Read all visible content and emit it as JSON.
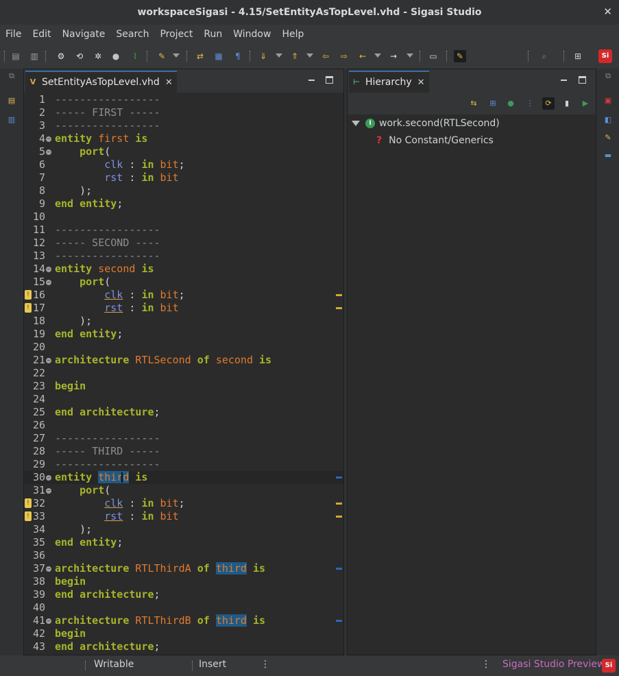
{
  "window": {
    "title": "workspaceSigasi - 4.15/SetEntityAsTopLevel.vhd - Sigasi Studio",
    "close": "✕"
  },
  "menu": [
    "File",
    "Edit",
    "Navigate",
    "Search",
    "Project",
    "Run",
    "Window",
    "Help"
  ],
  "toolbar": {
    "buttons": [
      {
        "name": "save-icon",
        "glyph": "▤",
        "color": "#9aa0a6"
      },
      {
        "name": "save-all-icon",
        "glyph": "▥",
        "color": "#9aa0a6"
      },
      {
        "name": "run-icon",
        "glyph": "⚙",
        "color": "#e6e6e6"
      },
      {
        "name": "simulate-icon",
        "glyph": "⟲",
        "color": "#e6e6e6"
      },
      {
        "name": "debug-icon",
        "glyph": "✲",
        "color": "#e6e6e6"
      },
      {
        "name": "stop-icon",
        "glyph": "●",
        "color": "#c0c2c4"
      },
      {
        "name": "wave-icon",
        "glyph": "⌇",
        "color": "#49a34b"
      },
      {
        "name": "highlight-icon",
        "glyph": "✎",
        "color": "#e8b64a"
      },
      {
        "name": "open-type-icon",
        "glyph": "⇄",
        "color": "#e8b64a"
      },
      {
        "name": "outline-icon",
        "glyph": "▦",
        "color": "#5b8ed6"
      },
      {
        "name": "pilcrow-icon",
        "glyph": "¶",
        "color": "#5b8ed6"
      },
      {
        "name": "next-annotation-icon",
        "glyph": "⇓",
        "color": "#e8b64a"
      },
      {
        "name": "prev-annotation-icon",
        "glyph": "⇑",
        "color": "#e8b64a"
      },
      {
        "name": "last-edit-icon",
        "glyph": "⇦",
        "color": "#e8b64a"
      },
      {
        "name": "next-edit-icon",
        "glyph": "⇨",
        "color": "#e8b64a"
      },
      {
        "name": "back-icon",
        "glyph": "←",
        "color": "#e8b64a"
      },
      {
        "name": "forward-icon",
        "glyph": "→",
        "color": "#e6e6e6"
      },
      {
        "name": "terminal-icon",
        "glyph": "▭",
        "color": "#cfd2d4"
      },
      {
        "name": "edit-mode-icon",
        "glyph": "✎",
        "color": "#e8b64a"
      },
      {
        "name": "search-icon",
        "glyph": "⌕",
        "color": "#8a8c8e"
      },
      {
        "name": "perspective-icon",
        "glyph": "⊞",
        "color": "#cfd2d4"
      }
    ]
  },
  "editor": {
    "tab": {
      "label": "SetEntityAsTopLevel.vhd",
      "icon": "vhdl-file-icon",
      "close": "✕"
    },
    "lines": [
      {
        "n": "1",
        "parts": [
          {
            "c": "cmt",
            "t": "-----------------"
          }
        ]
      },
      {
        "n": "2",
        "parts": [
          {
            "c": "cmt",
            "t": "----- FIRST -----"
          }
        ]
      },
      {
        "n": "3",
        "parts": [
          {
            "c": "cmt",
            "t": "-----------------"
          }
        ]
      },
      {
        "n": "4",
        "fold": true,
        "parts": [
          {
            "c": "kw",
            "t": "entity"
          },
          {
            "c": "sym",
            "t": " "
          },
          {
            "c": "ident",
            "t": "first"
          },
          {
            "c": "sym",
            "t": " "
          },
          {
            "c": "kw",
            "t": "is"
          }
        ]
      },
      {
        "n": "5",
        "fold": true,
        "parts": [
          {
            "c": "sym",
            "t": "    "
          },
          {
            "c": "kw",
            "t": "port"
          },
          {
            "c": "sym",
            "t": "("
          }
        ]
      },
      {
        "n": "6",
        "parts": [
          {
            "c": "sym",
            "t": "        "
          },
          {
            "c": "port",
            "t": "clk"
          },
          {
            "c": "sym",
            "t": " : "
          },
          {
            "c": "kw",
            "t": "in"
          },
          {
            "c": "sym",
            "t": " "
          },
          {
            "c": "ident",
            "t": "bit"
          },
          {
            "c": "sym",
            "t": ";"
          }
        ]
      },
      {
        "n": "7",
        "parts": [
          {
            "c": "sym",
            "t": "        "
          },
          {
            "c": "port",
            "t": "rst"
          },
          {
            "c": "sym",
            "t": " : "
          },
          {
            "c": "kw",
            "t": "in"
          },
          {
            "c": "sym",
            "t": " "
          },
          {
            "c": "ident",
            "t": "bit"
          }
        ]
      },
      {
        "n": "8",
        "parts": [
          {
            "c": "sym",
            "t": "    );"
          }
        ]
      },
      {
        "n": "9",
        "parts": [
          {
            "c": "kw",
            "t": "end"
          },
          {
            "c": "sym",
            "t": " "
          },
          {
            "c": "kw",
            "t": "entity"
          },
          {
            "c": "sym",
            "t": ";"
          }
        ]
      },
      {
        "n": "10",
        "parts": []
      },
      {
        "n": "11",
        "parts": [
          {
            "c": "cmt",
            "t": "-----------------"
          }
        ]
      },
      {
        "n": "12",
        "parts": [
          {
            "c": "cmt",
            "t": "----- SECOND ----"
          }
        ]
      },
      {
        "n": "13",
        "parts": [
          {
            "c": "cmt",
            "t": "-----------------"
          }
        ]
      },
      {
        "n": "14",
        "fold": true,
        "parts": [
          {
            "c": "kw",
            "t": "entity"
          },
          {
            "c": "sym",
            "t": " "
          },
          {
            "c": "ident",
            "t": "second"
          },
          {
            "c": "sym",
            "t": " "
          },
          {
            "c": "kw",
            "t": "is"
          }
        ]
      },
      {
        "n": "15",
        "fold": true,
        "parts": [
          {
            "c": "sym",
            "t": "    "
          },
          {
            "c": "kw",
            "t": "port"
          },
          {
            "c": "sym",
            "t": "("
          }
        ]
      },
      {
        "n": "16",
        "marker": true,
        "ovr": "warn",
        "parts": [
          {
            "c": "sym",
            "t": "        "
          },
          {
            "c": "port warn",
            "t": "clk"
          },
          {
            "c": "sym",
            "t": " : "
          },
          {
            "c": "kw",
            "t": "in"
          },
          {
            "c": "sym",
            "t": " "
          },
          {
            "c": "ident",
            "t": "bit"
          },
          {
            "c": "sym",
            "t": ";"
          }
        ]
      },
      {
        "n": "17",
        "marker": true,
        "ovr": "warn",
        "parts": [
          {
            "c": "sym",
            "t": "        "
          },
          {
            "c": "port warn",
            "t": "rst"
          },
          {
            "c": "sym",
            "t": " : "
          },
          {
            "c": "kw",
            "t": "in"
          },
          {
            "c": "sym",
            "t": " "
          },
          {
            "c": "ident",
            "t": "bit"
          }
        ]
      },
      {
        "n": "18",
        "parts": [
          {
            "c": "sym",
            "t": "    );"
          }
        ]
      },
      {
        "n": "19",
        "parts": [
          {
            "c": "kw",
            "t": "end"
          },
          {
            "c": "sym",
            "t": " "
          },
          {
            "c": "kw",
            "t": "entity"
          },
          {
            "c": "sym",
            "t": ";"
          }
        ]
      },
      {
        "n": "20",
        "parts": []
      },
      {
        "n": "21",
        "fold": true,
        "parts": [
          {
            "c": "kw",
            "t": "architecture"
          },
          {
            "c": "sym",
            "t": " "
          },
          {
            "c": "ident",
            "t": "RTLSecond"
          },
          {
            "c": "sym",
            "t": " "
          },
          {
            "c": "kw",
            "t": "of"
          },
          {
            "c": "sym",
            "t": " "
          },
          {
            "c": "ident",
            "t": "second"
          },
          {
            "c": "sym",
            "t": " "
          },
          {
            "c": "kw",
            "t": "is"
          }
        ]
      },
      {
        "n": "22",
        "parts": []
      },
      {
        "n": "23",
        "parts": [
          {
            "c": "kw",
            "t": "begin"
          }
        ]
      },
      {
        "n": "24",
        "parts": []
      },
      {
        "n": "25",
        "parts": [
          {
            "c": "kw",
            "t": "end"
          },
          {
            "c": "sym",
            "t": " "
          },
          {
            "c": "kw",
            "t": "architecture"
          },
          {
            "c": "sym",
            "t": ";"
          }
        ]
      },
      {
        "n": "26",
        "parts": []
      },
      {
        "n": "27",
        "parts": [
          {
            "c": "cmt",
            "t": "-----------------"
          }
        ]
      },
      {
        "n": "28",
        "parts": [
          {
            "c": "cmt",
            "t": "----- THIRD -----"
          }
        ]
      },
      {
        "n": "29",
        "parts": [
          {
            "c": "cmt",
            "t": "-----------------"
          }
        ]
      },
      {
        "n": "30",
        "fold": true,
        "current": true,
        "ovr": "occ",
        "parts": [
          {
            "c": "kw",
            "t": "entity"
          },
          {
            "c": "sym",
            "t": " "
          },
          {
            "c": "ident hl",
            "t": "third"
          },
          {
            "c": "sym",
            "t": " "
          },
          {
            "c": "kw",
            "t": "is"
          }
        ]
      },
      {
        "n": "31",
        "fold": true,
        "parts": [
          {
            "c": "sym",
            "t": "    "
          },
          {
            "c": "kw",
            "t": "port"
          },
          {
            "c": "sym",
            "t": "("
          }
        ]
      },
      {
        "n": "32",
        "marker": true,
        "ovr": "warn",
        "parts": [
          {
            "c": "sym",
            "t": "        "
          },
          {
            "c": "port warn",
            "t": "clk"
          },
          {
            "c": "sym",
            "t": " : "
          },
          {
            "c": "kw",
            "t": "in"
          },
          {
            "c": "sym",
            "t": " "
          },
          {
            "c": "ident",
            "t": "bit"
          },
          {
            "c": "sym",
            "t": ";"
          }
        ]
      },
      {
        "n": "33",
        "marker": true,
        "ovr": "warn",
        "parts": [
          {
            "c": "sym",
            "t": "        "
          },
          {
            "c": "port warn",
            "t": "rst"
          },
          {
            "c": "sym",
            "t": " : "
          },
          {
            "c": "kw",
            "t": "in"
          },
          {
            "c": "sym",
            "t": " "
          },
          {
            "c": "ident",
            "t": "bit"
          }
        ]
      },
      {
        "n": "34",
        "parts": [
          {
            "c": "sym",
            "t": "    );"
          }
        ]
      },
      {
        "n": "35",
        "parts": [
          {
            "c": "kw",
            "t": "end"
          },
          {
            "c": "sym",
            "t": " "
          },
          {
            "c": "kw",
            "t": "entity"
          },
          {
            "c": "sym",
            "t": ";"
          }
        ]
      },
      {
        "n": "36",
        "parts": []
      },
      {
        "n": "37",
        "fold": true,
        "ovr": "occ",
        "parts": [
          {
            "c": "kw",
            "t": "architecture"
          },
          {
            "c": "sym",
            "t": " "
          },
          {
            "c": "ident",
            "t": "RTLThirdA"
          },
          {
            "c": "sym",
            "t": " "
          },
          {
            "c": "kw",
            "t": "of"
          },
          {
            "c": "sym",
            "t": " "
          },
          {
            "c": "ident hl",
            "t": "third"
          },
          {
            "c": "sym",
            "t": " "
          },
          {
            "c": "kw",
            "t": "is"
          }
        ]
      },
      {
        "n": "38",
        "parts": [
          {
            "c": "kw",
            "t": "begin"
          }
        ]
      },
      {
        "n": "39",
        "parts": [
          {
            "c": "kw",
            "t": "end"
          },
          {
            "c": "sym",
            "t": " "
          },
          {
            "c": "kw",
            "t": "architecture"
          },
          {
            "c": "sym",
            "t": ";"
          }
        ]
      },
      {
        "n": "40",
        "parts": []
      },
      {
        "n": "41",
        "fold": true,
        "ovr": "occ",
        "parts": [
          {
            "c": "kw",
            "t": "architecture"
          },
          {
            "c": "sym",
            "t": " "
          },
          {
            "c": "ident",
            "t": "RTLThirdB"
          },
          {
            "c": "sym",
            "t": " "
          },
          {
            "c": "kw",
            "t": "of"
          },
          {
            "c": "sym",
            "t": " "
          },
          {
            "c": "ident hl",
            "t": "third"
          },
          {
            "c": "sym",
            "t": " "
          },
          {
            "c": "kw",
            "t": "is"
          }
        ]
      },
      {
        "n": "42",
        "parts": [
          {
            "c": "kw",
            "t": "begin"
          }
        ]
      },
      {
        "n": "43",
        "parts": [
          {
            "c": "kw",
            "t": "end"
          },
          {
            "c": "sym",
            "t": " "
          },
          {
            "c": "kw",
            "t": "architecture"
          },
          {
            "c": "sym",
            "t": ";"
          }
        ]
      }
    ]
  },
  "hierarchy": {
    "tab": {
      "label": "Hierarchy",
      "icon": "hierarchy-icon",
      "close": "✕"
    },
    "buttons": [
      {
        "name": "toggle-direction-icon",
        "glyph": "⇆",
        "color": "#e8b64a"
      },
      {
        "name": "expand-all-icon",
        "glyph": "⊞",
        "color": "#5b8ed6"
      },
      {
        "name": "set-top-icon",
        "glyph": "●",
        "color": "#3c9b5a"
      },
      {
        "name": "filter-icon",
        "glyph": "⋮",
        "color": "#5b8ed6"
      },
      {
        "name": "refresh-icon",
        "glyph": "⟳",
        "color": "#e8b64a"
      },
      {
        "name": "pin-icon",
        "glyph": "▮",
        "color": "#cfd2d4"
      },
      {
        "name": "simulate-icon",
        "glyph": "▶",
        "color": "#3c9b5a"
      }
    ],
    "root": {
      "label": "work.second(RTLSecond)",
      "icon": "I"
    },
    "child": {
      "label": "No Constant/Generics",
      "icon": "?"
    }
  },
  "status": {
    "writable": "Writable",
    "insert": "Insert",
    "preview": "Sigasi Studio Preview",
    "logo": "Si"
  },
  "colors": {
    "accent": "#3b6ea5",
    "warning": "#d5a73a",
    "keyword": "#a8b62b",
    "identifier": "#e07b2f",
    "port": "#7e8fe0",
    "highlight": "#1e5a86"
  }
}
